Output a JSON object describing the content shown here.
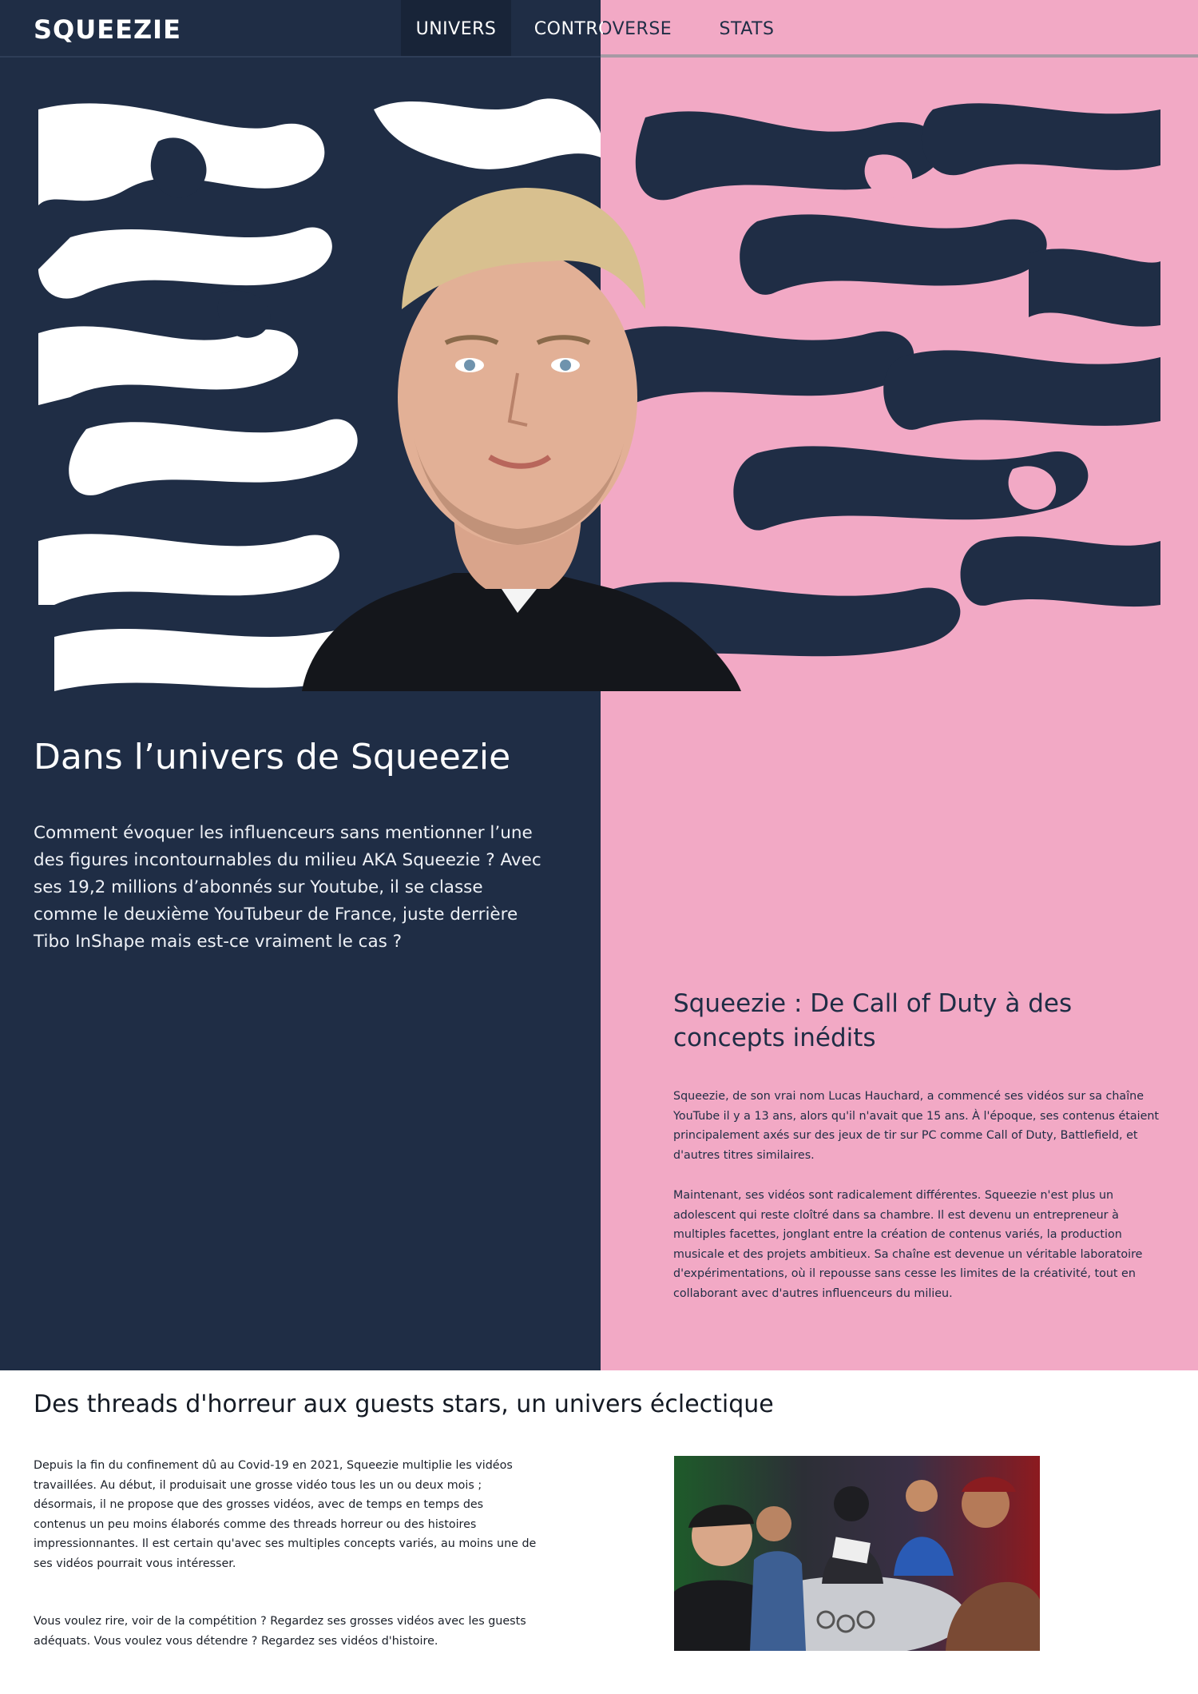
{
  "colors": {
    "navy": "#1f2d45",
    "pink": "#f2a9c5",
    "white": "#ffffff"
  },
  "nav": {
    "brand": "SQUEEZIE",
    "tabs": [
      {
        "label": "UNIVERS",
        "active": true
      },
      {
        "label": "CONTROVERSE",
        "active": false
      },
      {
        "label": "STATS",
        "active": false
      }
    ]
  },
  "hero": {
    "image": "portrait-photo-with-marbled-background"
  },
  "intro": {
    "title": "Dans l’univers de Squeezie",
    "text": "Comment évoquer les influenceurs sans mentionner l’une des figures incontournables du milieu AKA Squeezie ? Avec ses 19,2 millions d’abonnés sur Youtube, il se classe comme le deuxième YouTubeur de France, juste derrière Tibo InShape mais est-ce vraiment le cas ?"
  },
  "section1": {
    "title": "Squeezie : De Call of Duty à des concepts inédits",
    "paragraphs": [
      "Squeezie, de son vrai nom Lucas Hauchard, a commencé ses vidéos sur sa chaîne YouTube il y a 13 ans, alors qu'il n'avait que 15 ans. À l'époque, ses contenus étaient principalement axés sur des jeux de tir sur PC comme Call of Duty, Battlefield, et d'autres titres similaires.",
      "Maintenant, ses vidéos sont radicalement différentes. Squeezie n'est plus un adolescent qui reste cloîtré dans sa chambre. Il est devenu un entrepreneur à multiples facettes, jonglant entre la création de contenus variés, la production musicale et des projets ambitieux. Sa chaîne est devenue un véritable laboratoire d'expérimentations, où il repousse sans cesse les limites de la créativité, tout en collaborant avec d'autres influenceurs du milieu."
    ]
  },
  "section2": {
    "title": "Des threads d'horreur aux guests stars, un univers éclectique",
    "paragraphs": [
      "Depuis la fin du confinement dû au Covid-19 en 2021, Squeezie multiplie les vidéos travaillées. Au début, il produisait une grosse vidéo tous les un ou deux mois ; désormais, il ne propose que des grosses vidéos, avec de temps en temps des contenus un peu moins élaborés comme des threads horreur ou des histoires impressionnantes. Il est certain qu'avec ses multiples concepts variés, au moins une de ses vidéos pourrait vous intéresser.",
      "Vous voulez rire, voir de la compétition ? Regardez ses grosses vidéos avec les guests adéquats. Vous voulez vous détendre ? Regardez ses vidéos d'histoire."
    ],
    "thumbnail": "group-video-thumbnail"
  }
}
